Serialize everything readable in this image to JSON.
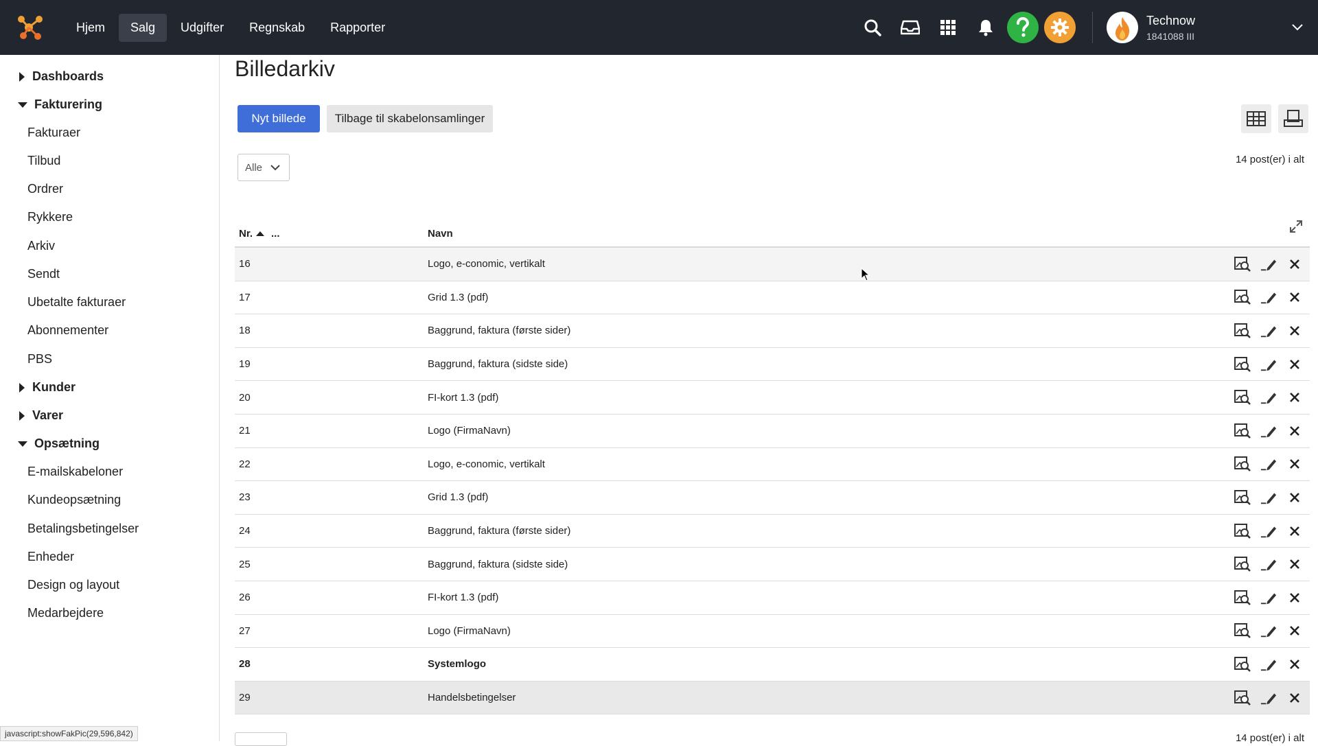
{
  "topnav": {
    "items": [
      {
        "label": "Hjem",
        "active": false
      },
      {
        "label": "Salg",
        "active": true
      },
      {
        "label": "Udgifter",
        "active": false
      },
      {
        "label": "Regnskab",
        "active": false
      },
      {
        "label": "Rapporter",
        "active": false
      }
    ],
    "icons": [
      "search-icon",
      "inbox-icon",
      "apps-icon",
      "bell-icon",
      "help-icon",
      "settings-icon"
    ],
    "user": {
      "name": "Technow",
      "id": "1841088 III"
    },
    "colors": {
      "bar": "#22262f",
      "help": "#2fb344",
      "settings": "#f0a035"
    }
  },
  "sidebar": {
    "sections": [
      {
        "label": "Dashboards",
        "expanded": false,
        "items": []
      },
      {
        "label": "Fakturering",
        "expanded": true,
        "items": [
          "Fakturaer",
          "Tilbud",
          "Ordrer",
          "Rykkere",
          "Arkiv",
          "Sendt",
          "Ubetalte fakturaer",
          "Abonnementer",
          "PBS"
        ]
      },
      {
        "label": "Kunder",
        "expanded": false,
        "items": []
      },
      {
        "label": "Varer",
        "expanded": false,
        "items": []
      },
      {
        "label": "Opsætning",
        "expanded": true,
        "items": [
          "E-mailskabeloner",
          "Kundeopsætning",
          "Betalingsbetingelser",
          "Enheder",
          "Design og layout",
          "Medarbejdere"
        ]
      }
    ]
  },
  "main": {
    "title": "Billedarkiv",
    "new_button": "Nyt billede",
    "back_button": "Tilbage til skabelonsamlinger",
    "filter": {
      "value": "Alle"
    },
    "count_top": "14 post(er) i alt",
    "count_bottom": "14 post(er) i alt",
    "table": {
      "headers": {
        "nr": "Nr.",
        "dots": "...",
        "navn": "Navn"
      },
      "rows": [
        {
          "nr": "16",
          "navn": "Logo, e-conomic, vertikalt"
        },
        {
          "nr": "17",
          "navn": "Grid 1.3 (pdf)"
        },
        {
          "nr": "18",
          "navn": "Baggrund, faktura (første sider)"
        },
        {
          "nr": "19",
          "navn": "Baggrund, faktura (sidste side)"
        },
        {
          "nr": "20",
          "navn": "FI-kort 1.3 (pdf)"
        },
        {
          "nr": "21",
          "navn": "Logo (FirmaNavn)"
        },
        {
          "nr": "22",
          "navn": "Logo, e-conomic, vertikalt"
        },
        {
          "nr": "23",
          "navn": "Grid 1.3 (pdf)"
        },
        {
          "nr": "24",
          "navn": "Baggrund, faktura (første sider)"
        },
        {
          "nr": "25",
          "navn": "Baggrund, faktura (sidste side)"
        },
        {
          "nr": "26",
          "navn": "FI-kort 1.3 (pdf)"
        },
        {
          "nr": "27",
          "navn": "Logo (FirmaNavn)"
        },
        {
          "nr": "28",
          "navn": "Systemlogo",
          "bold": true
        },
        {
          "nr": "29",
          "navn": "Handelsbetingelser"
        }
      ]
    }
  },
  "status_bar": "javascript:showFakPic(29,596,842)"
}
